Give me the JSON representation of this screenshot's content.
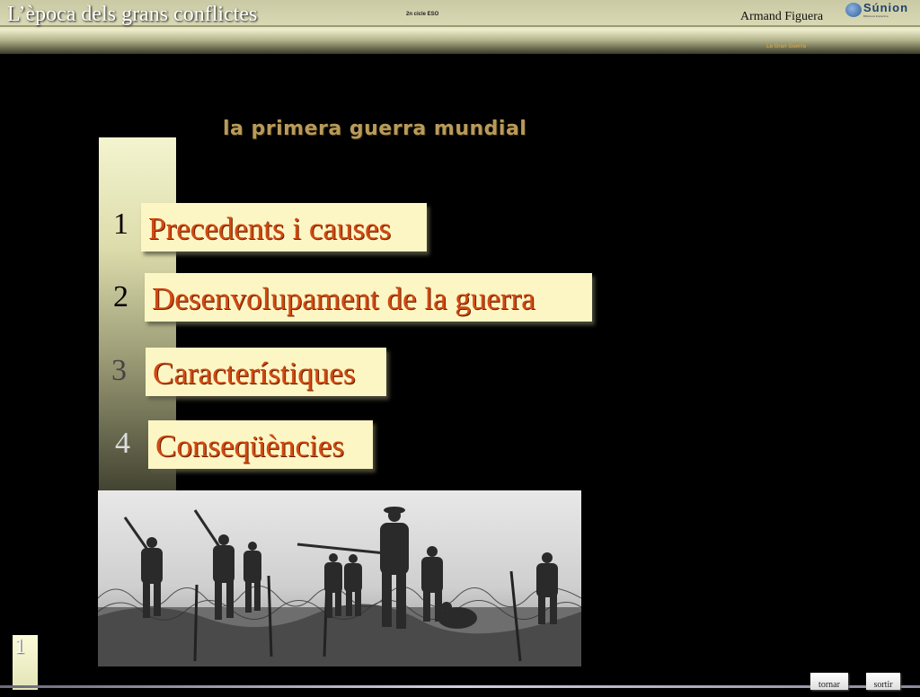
{
  "header": {
    "app_title": "L’època dels grans conflictes",
    "small_label": "2n cicle ESO",
    "author": "Armand Figuera",
    "logo_text": "Súnion",
    "logo_sub": "Biblioteca interactiva",
    "sub_header": "La Gran Guerra"
  },
  "main": {
    "page_title": "la primera guerra mundial",
    "menu": [
      {
        "num": "1",
        "label": "Precedents i causes"
      },
      {
        "num": "2",
        "label": "Desenvolupament de la guerra"
      },
      {
        "num": "3",
        "label": "Característiques"
      },
      {
        "num": "4",
        "label": "Conseqüències"
      }
    ]
  },
  "footer": {
    "page_number": "1",
    "back_label": "tornar",
    "exit_label": "sortir"
  },
  "colors": {
    "menu_text": "#d24a14",
    "menu_bg": "#fcf6c4",
    "title": "#b89a5a"
  }
}
